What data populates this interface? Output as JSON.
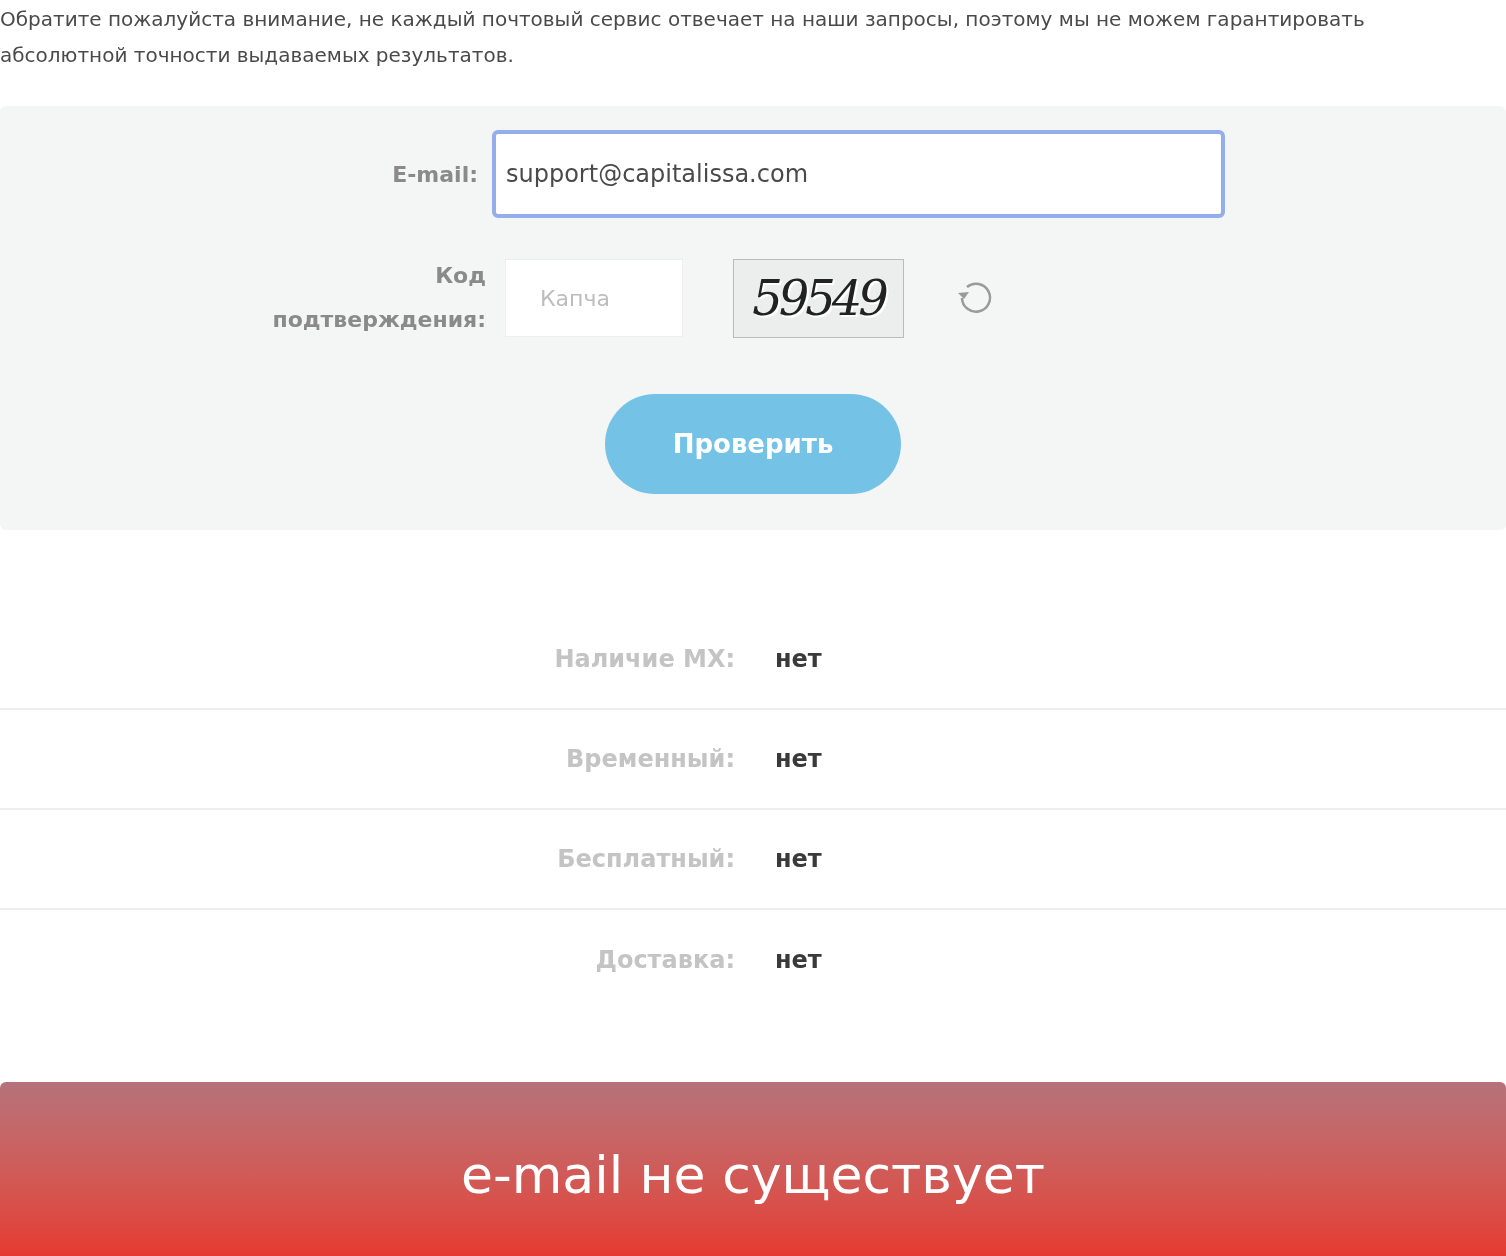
{
  "notice": "Обратите пожалуйста внимание, не каждый почтовый сервис отвечает на наши запросы, поэтому мы не можем гарантировать абсолютной точности выдаваемых результатов.",
  "form": {
    "email_label": "E-mail:",
    "email_value": "support@capitalissa.com",
    "code_label": "Код подтверждения:",
    "captcha_placeholder": "Капча",
    "captcha_code": "59549",
    "submit": "Проверить"
  },
  "results": [
    {
      "label": "Наличие MX:",
      "value": "нет"
    },
    {
      "label": "Временный:",
      "value": "нет"
    },
    {
      "label": "Бесплатный:",
      "value": "нет"
    },
    {
      "label": "Доставка:",
      "value": "нет"
    }
  ],
  "verdict": "e-mail не существует"
}
